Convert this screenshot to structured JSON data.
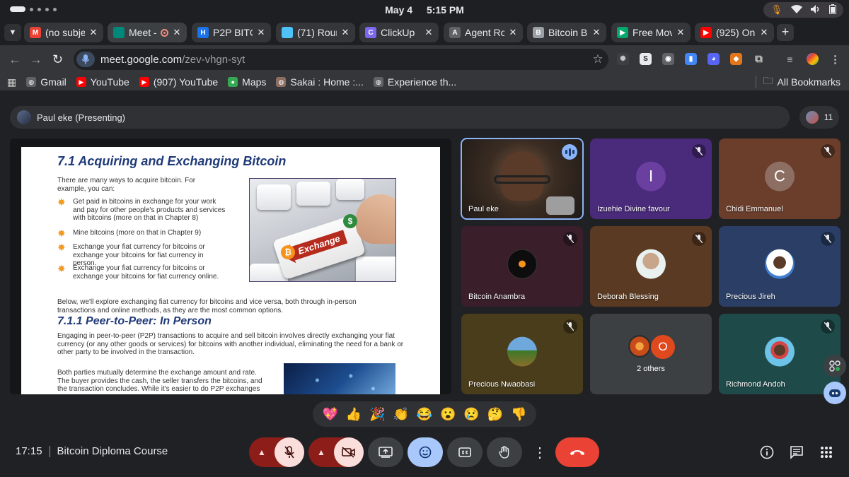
{
  "status_bar": {
    "date": "May 4",
    "time": "5:15 PM"
  },
  "tabs": [
    {
      "title": "(no subje",
      "fav_color": "#ea4335",
      "fav_glyph": "M",
      "active": false
    },
    {
      "title": "Meet -",
      "fav_color": "#00897b",
      "fav_glyph": "",
      "active": true,
      "recording": true
    },
    {
      "title": "P2P BITC",
      "fav_color": "#1a73e8",
      "fav_glyph": "H",
      "active": false
    },
    {
      "title": "(71) Rour",
      "fav_color": "#4fc3f7",
      "fav_glyph": "",
      "active": false
    },
    {
      "title": "ClickUp",
      "fav_color": "#7b68ee",
      "fav_glyph": "C",
      "active": false
    },
    {
      "title": "Agent Ro",
      "fav_color": "#5f6368",
      "fav_glyph": "A",
      "active": false
    },
    {
      "title": "Bitcoin B",
      "fav_color": "#9aa0a6",
      "fav_glyph": "B",
      "active": false
    },
    {
      "title": "Free Mov",
      "fav_color": "#00a86b",
      "fav_glyph": "▶",
      "active": false
    },
    {
      "title": "(925) On",
      "fav_color": "#ff0000",
      "fav_glyph": "▶",
      "active": false
    }
  ],
  "address_bar": {
    "host": "meet.google.com",
    "path": "/zev-vhgn-syt"
  },
  "bookmarks": [
    {
      "label": "Gmail",
      "icon": "globe-icon",
      "color": "#5f6368"
    },
    {
      "label": "YouTube",
      "icon": "youtube-icon",
      "color": "#ff0000"
    },
    {
      "label": "(907) YouTube",
      "icon": "youtube-icon",
      "color": "#ff0000"
    },
    {
      "label": "Maps",
      "icon": "maps-icon",
      "color": "#34a853"
    },
    {
      "label": "Sakai : Home :...",
      "icon": "sakai-icon",
      "color": "#8d6e63"
    },
    {
      "label": "Experience th...",
      "icon": "globe-icon",
      "color": "#5f6368"
    }
  ],
  "all_bookmarks": "All Bookmarks",
  "meet": {
    "presenting_label": "Paul eke (Presenting)",
    "participant_count": "11",
    "meeting_time": "17:15",
    "meeting_name": "Bitcoin Diploma Course"
  },
  "document": {
    "heading": "7.1 Acquiring and Exchanging Bitcoin",
    "intro": "There are many ways to acquire bitcoin. For example, you can:",
    "bullets": [
      "Get paid in bitcoins in exchange for your work and pay for other people's products and services with bitcoins (more on that in Chapter 8)",
      "Mine bitcoins (more on that in Chapter 9)",
      "Exchange your fiat currency for bitcoins or exchange your bitcoins for fiat currency in person.",
      "Exchange your fiat currency for bitcoins or exchange your bitcoins for fiat currency online."
    ],
    "below": "Below, we'll explore exchanging fiat currency for bitcoins and vice versa, both through in-person transactions and online methods, as they are the most common options.",
    "subheading": "7.1.1 Peer-to-Peer: In Person",
    "p2p": "Engaging in peer-to-peer (P2P) transactions to acquire and sell bitcoin involves directly exchanging your fiat currency (or any other goods or services) for bitcoins with another individual, eliminating the need for a bank or other party to be involved in the transaction.",
    "parties": "Both parties mutually determine the exchange amount and rate. The buyer provides the cash, the seller transfers the bitcoins, and the transaction concludes. While it's easier to do P2P exchanges",
    "image_key_label": "Exchange"
  },
  "participants": [
    {
      "name": "Paul eke",
      "initial": "",
      "bg": "#2b2622",
      "speaking": true,
      "muted": false
    },
    {
      "name": "Izuehie Divine favour",
      "initial": "I",
      "bg": "#4a2a7a",
      "avatar_bg": "#6b3fa0",
      "muted": true
    },
    {
      "name": "Chidi Emmanuel",
      "initial": "C",
      "bg": "#6b3e2c",
      "avatar_bg": "#8d6e63",
      "muted": true
    },
    {
      "name": "Bitcoin Anambra",
      "initial": "",
      "bg": "#3a1f2b",
      "muted": true
    },
    {
      "name": "Deborah Blessing",
      "initial": "",
      "bg": "#5a3a22",
      "muted": true
    },
    {
      "name": "Precious Jireh",
      "initial": "",
      "bg": "#2b3f66",
      "muted": true
    },
    {
      "name": "Precious Nwaobasi",
      "initial": "",
      "bg": "#4a3d1c",
      "muted": true
    },
    {
      "name": "2 others",
      "initial": "O",
      "bg": "#3c4043",
      "muted": false
    },
    {
      "name": "Richmond Andoh",
      "initial": "",
      "bg": "#1f4a4a",
      "muted": true
    }
  ],
  "reactions": [
    "💖",
    "👍",
    "🎉",
    "👏",
    "😂",
    "😮",
    "😢",
    "🤔",
    "👎"
  ]
}
